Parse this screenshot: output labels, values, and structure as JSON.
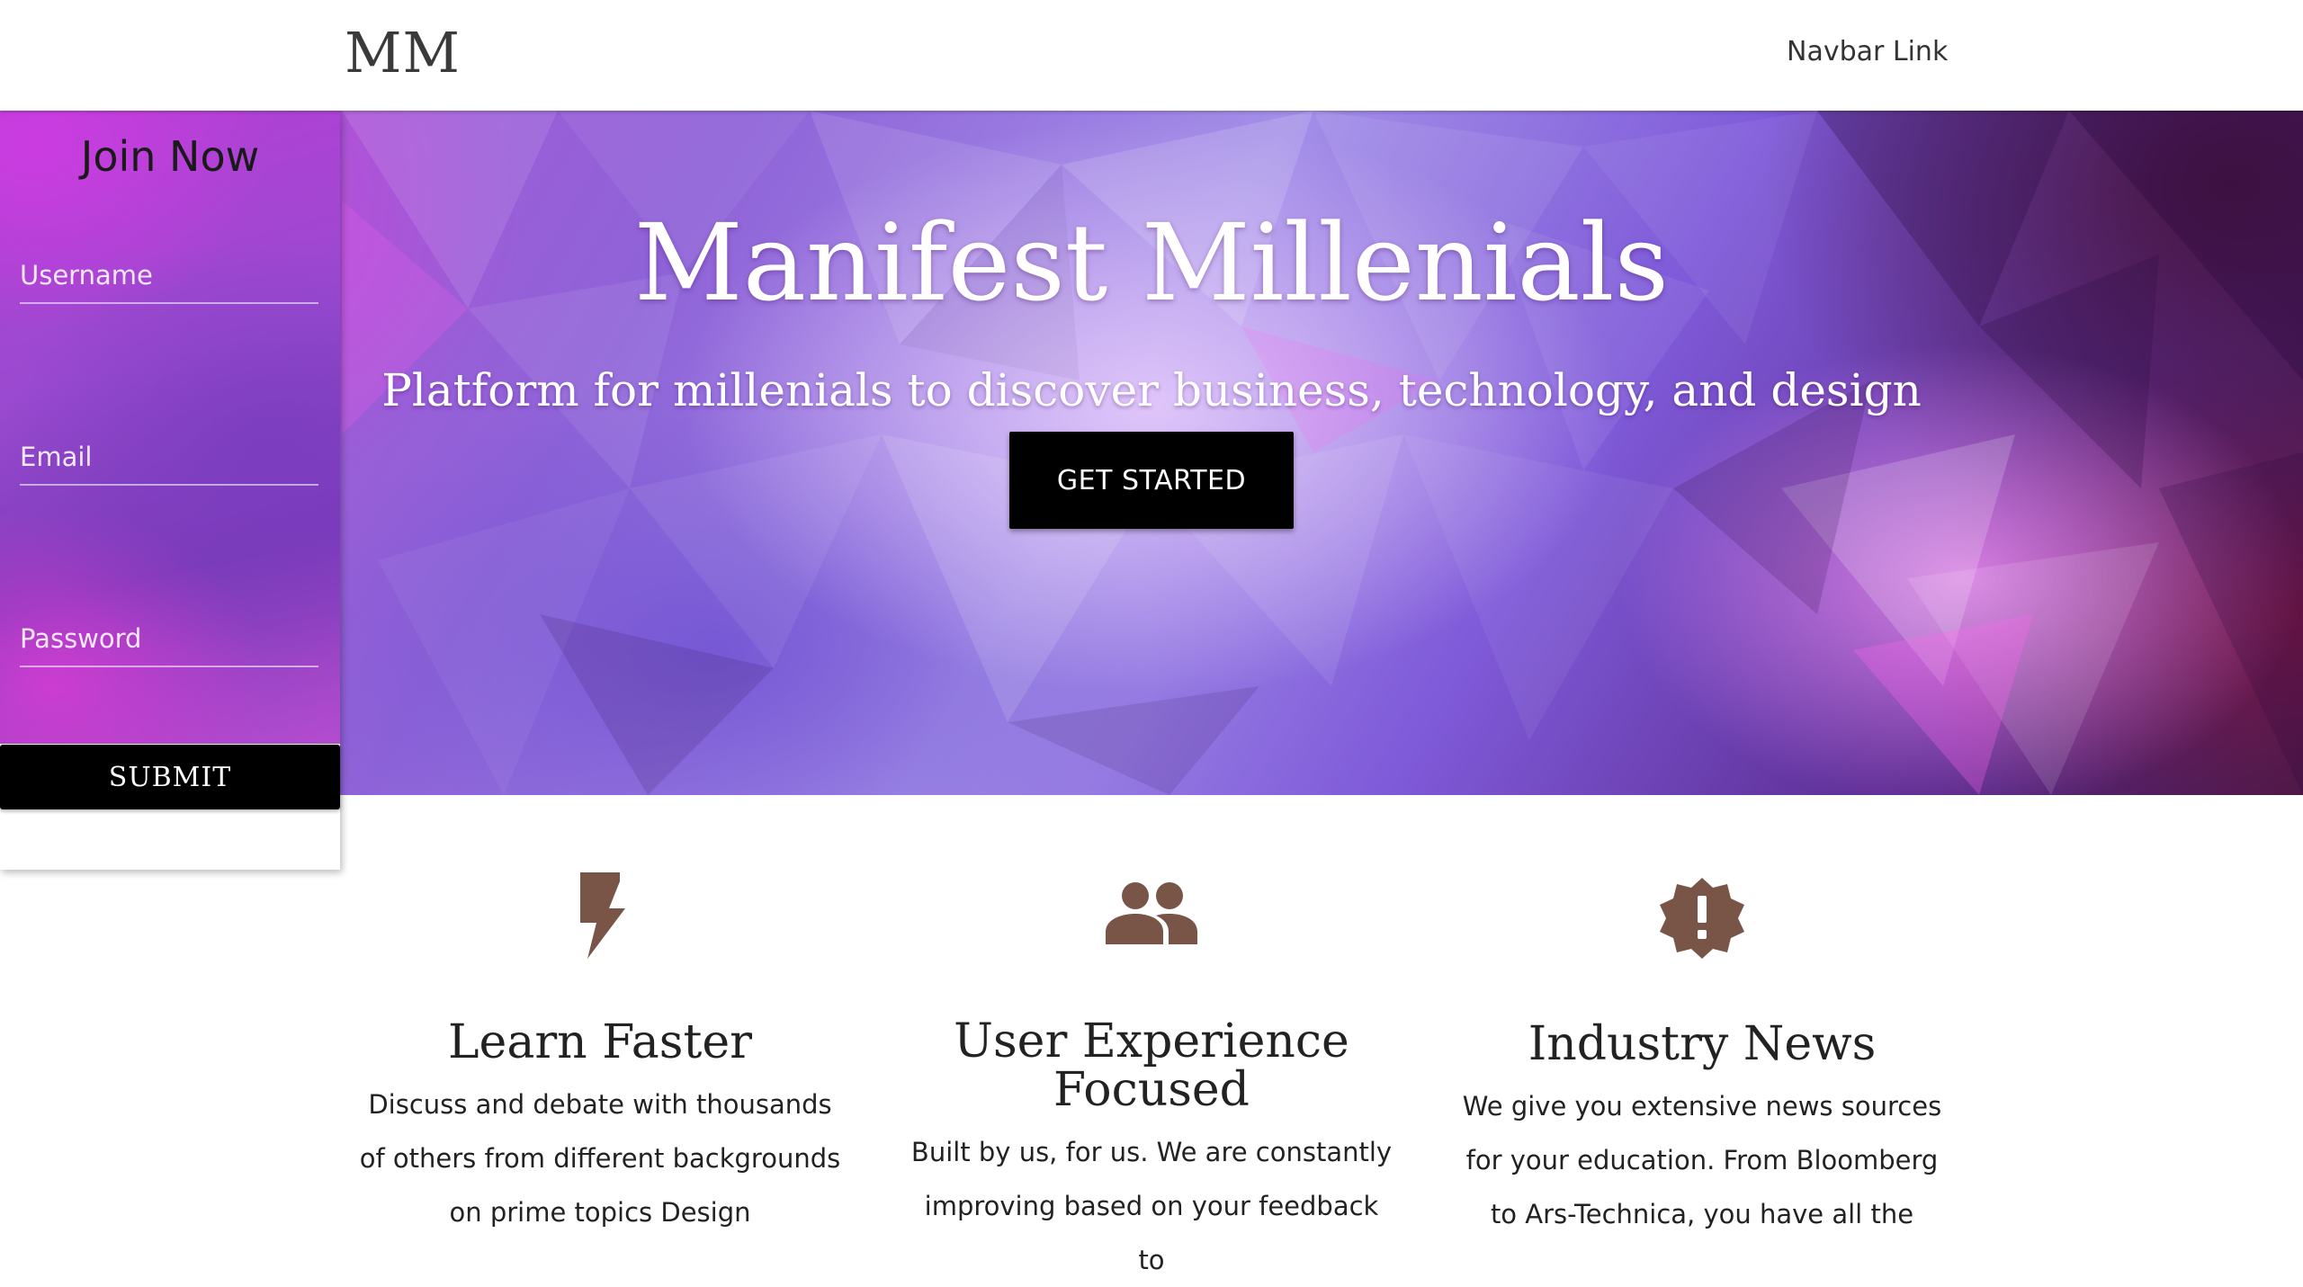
{
  "navbar": {
    "brand": "MM",
    "link_label": "Navbar Link"
  },
  "hero": {
    "title": "Manifest Millenials",
    "subtitle": "Platform for millenials to discover business, technology, and design",
    "cta_label": "GET STARTED"
  },
  "join": {
    "title": "Join Now",
    "username_placeholder": "Username",
    "email_placeholder": "Email",
    "password_placeholder": "Password",
    "submit_label": "SUBMIT"
  },
  "features": [
    {
      "icon": "lightning-bolt-icon",
      "title": "Learn Faster",
      "text": "Discuss and debate with thousands of others from different backgrounds on prime topics Design"
    },
    {
      "icon": "people-group-icon",
      "title": "User Experience Focused",
      "text": "Built by us, for us. We are constantly improving based on your feedback to"
    },
    {
      "icon": "new-releases-badge-icon",
      "title": "Industry News",
      "text": "We give you extensive news sources for your education. From Bloomberg to Ars-Technica, you have all the"
    }
  ],
  "colors": {
    "icon_brown": "#795548",
    "cta_background": "#000000",
    "hero_purple": "#8f63d8"
  }
}
